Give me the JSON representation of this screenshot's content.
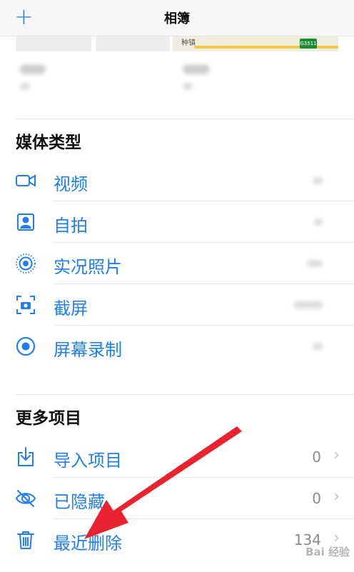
{
  "nav": {
    "title": "相簿",
    "add_symbol": "+"
  },
  "map": {
    "label": "种镇",
    "road_shield": "G3511"
  },
  "sections": {
    "media": {
      "header": "媒体类型",
      "items": [
        {
          "label": "视频",
          "icon": "video-icon"
        },
        {
          "label": "自拍",
          "icon": "selfie-icon"
        },
        {
          "label": "实况照片",
          "icon": "live-photo-icon"
        },
        {
          "label": "截屏",
          "icon": "screenshot-icon"
        },
        {
          "label": "屏幕录制",
          "icon": "screen-recording-icon"
        }
      ]
    },
    "more": {
      "header": "更多项目",
      "items": [
        {
          "label": "导入项目",
          "count": "0",
          "icon": "import-icon"
        },
        {
          "label": "已隐藏",
          "count": "0",
          "icon": "hidden-eye-icon"
        },
        {
          "label": "最近删除",
          "count": "134",
          "icon": "trash-icon"
        }
      ]
    }
  },
  "watermark": "Bai 经验",
  "colors": {
    "accent": "#1e7ef2",
    "arrow": "#e8222e"
  }
}
